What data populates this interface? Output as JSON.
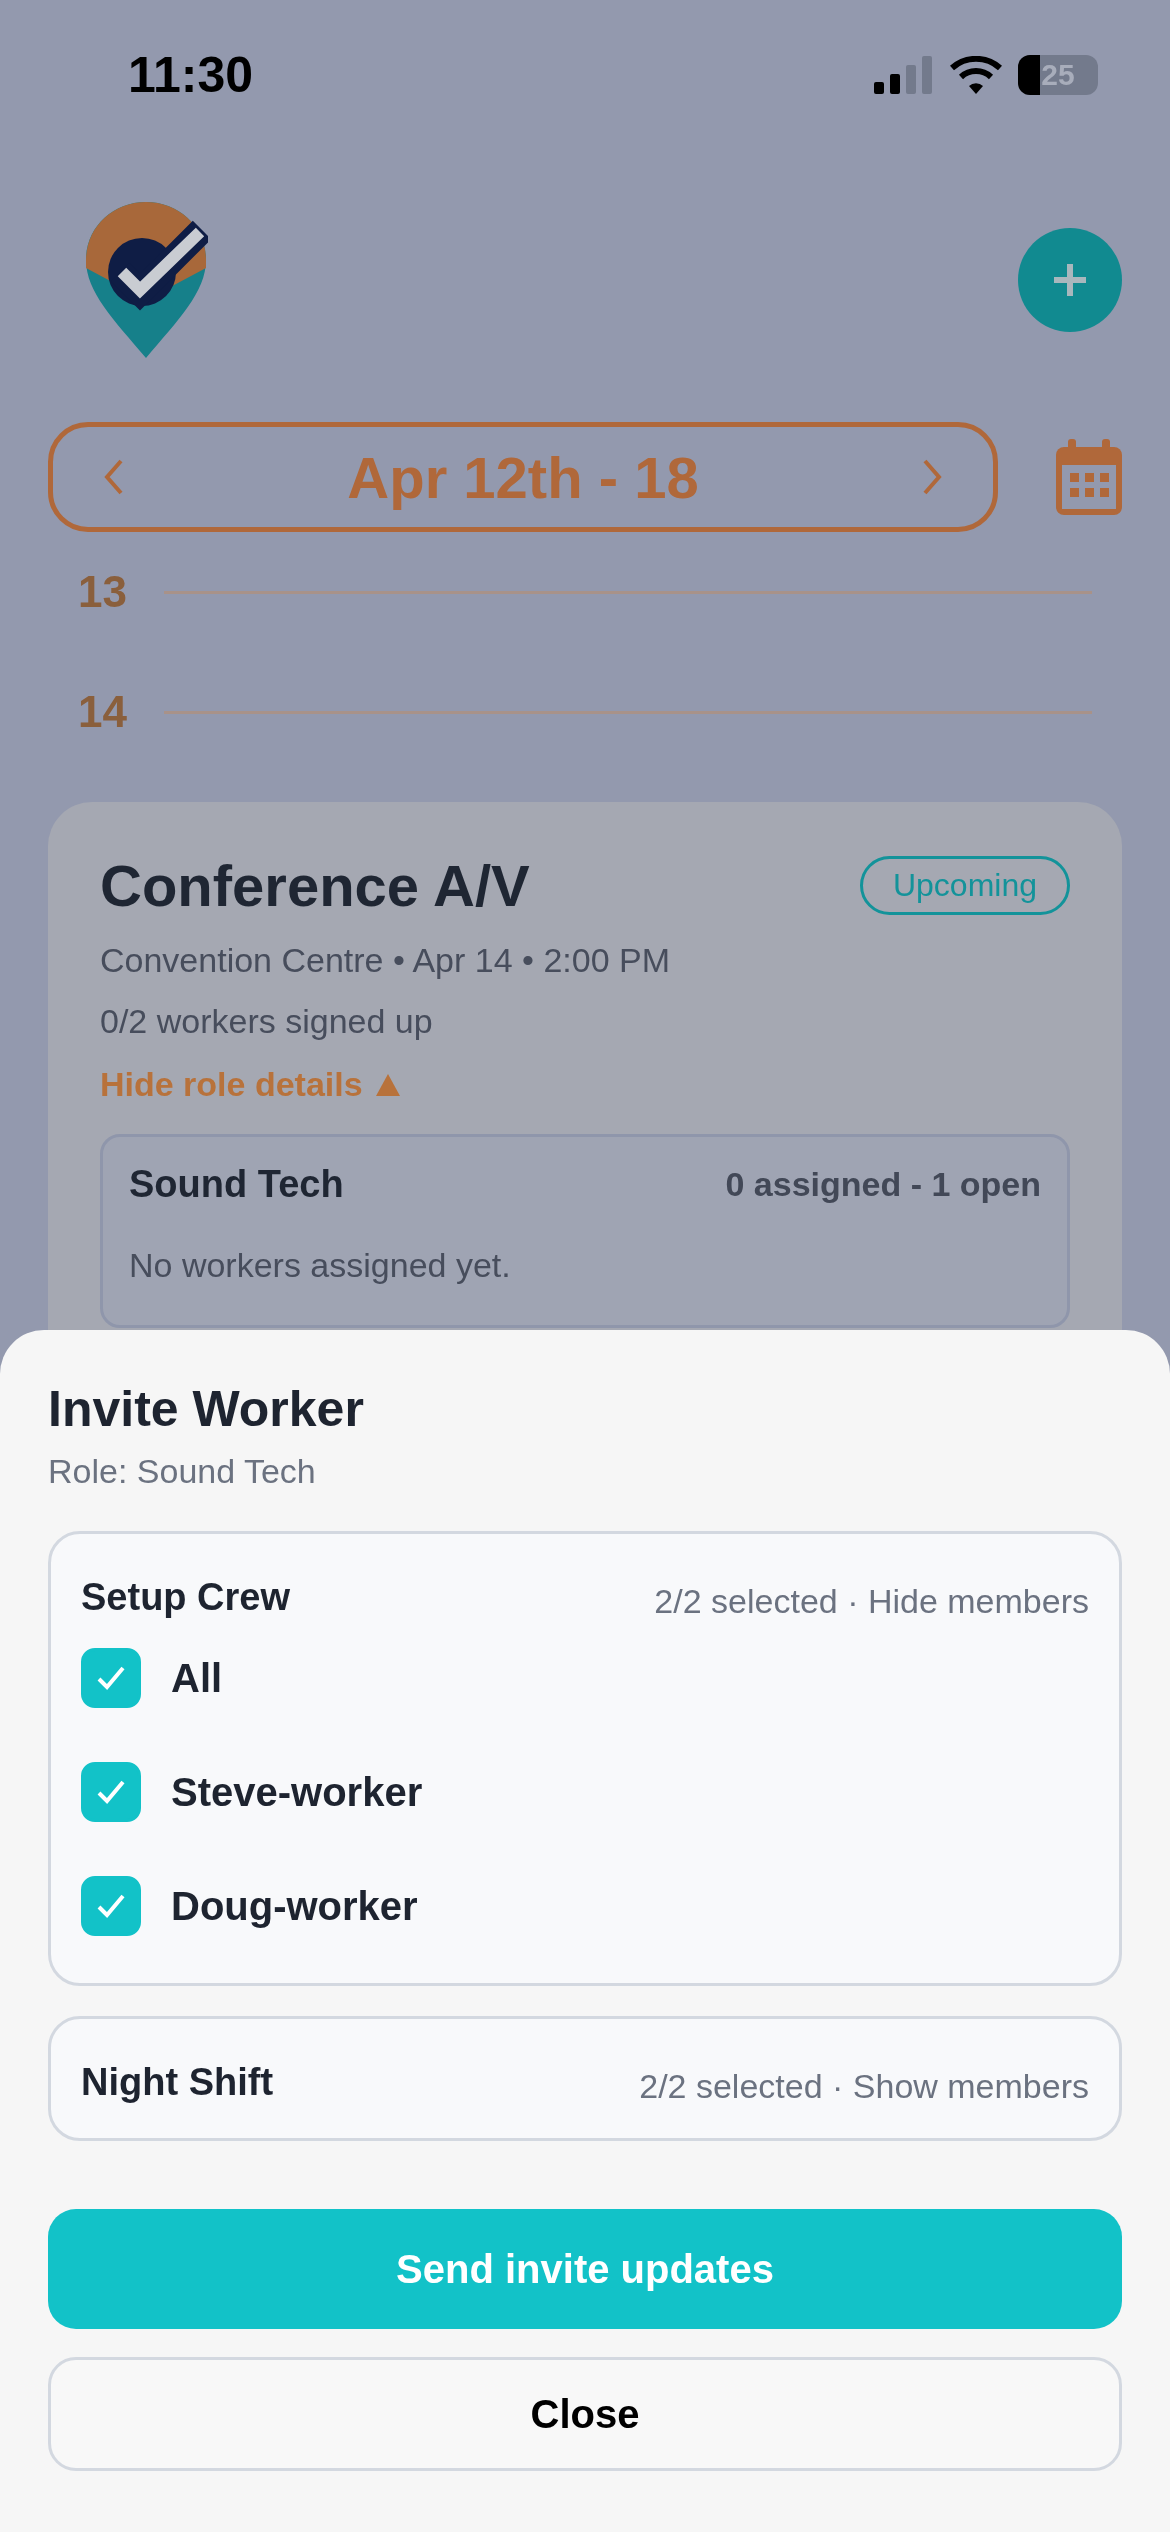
{
  "status_bar": {
    "time": "11:30",
    "battery": "25"
  },
  "week_nav": {
    "label": "Apr 12th - 18"
  },
  "timeline": [
    {
      "label": "13"
    },
    {
      "label": "14"
    }
  ],
  "event": {
    "title": "Conference A/V",
    "status": "Upcoming",
    "details": "Convention Centre • Apr 14 • 2:00 PM",
    "signup": "0/2 workers signed up",
    "toggle": "Hide role details",
    "expanded": true,
    "roles": [
      {
        "name": "Sound Tech",
        "counts": "0 assigned - 1 open",
        "empty": "No workers assigned yet."
      }
    ]
  },
  "sheet": {
    "title": "Invite Worker",
    "subtitle": "Role: Sound Tech",
    "groups": [
      {
        "name": "Setup Crew",
        "summary": "2/2 selected · Hide members",
        "members": [
          {
            "name": "All",
            "checked": true
          },
          {
            "name": "Steve-worker",
            "checked": true
          },
          {
            "name": "Doug-worker",
            "checked": true
          }
        ]
      },
      {
        "name": "Night Shift",
        "summary": "2/2 selected · Show members"
      }
    ],
    "primary": "Send invite updates",
    "secondary": "Close"
  }
}
